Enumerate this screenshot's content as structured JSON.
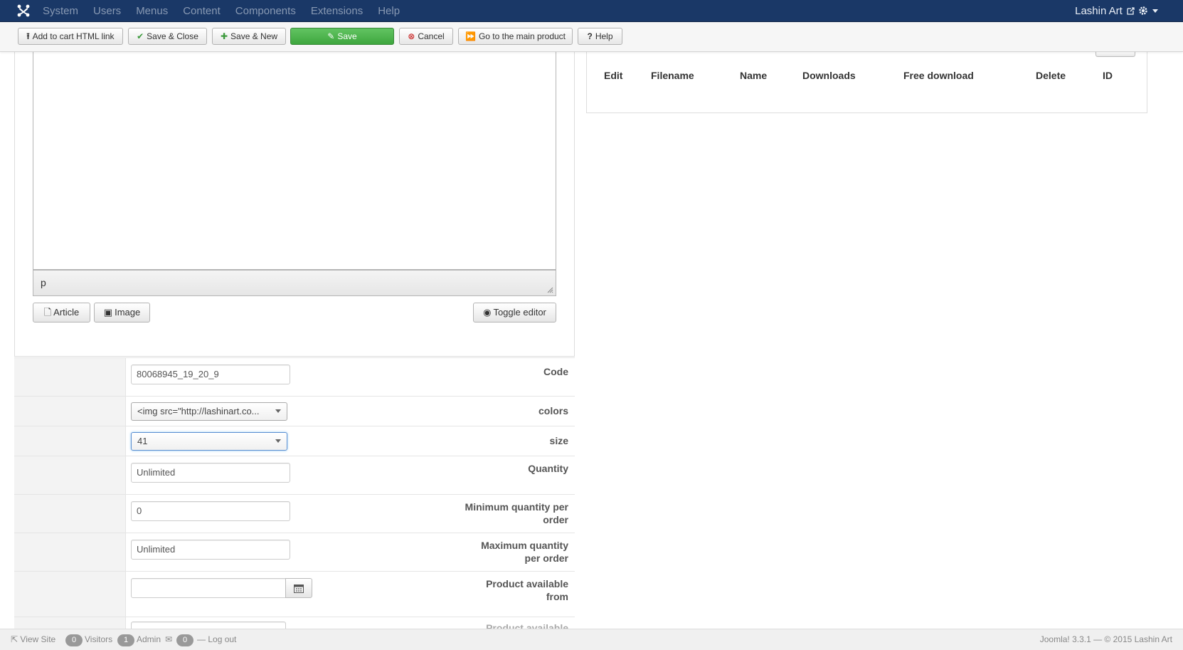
{
  "navbar": {
    "menu": [
      "System",
      "Users",
      "Menus",
      "Content",
      "Components",
      "Extensions",
      "Help"
    ],
    "user": "Lashin Art",
    "colors": {
      "bg": "#1a3867",
      "menu_text": "#8899b3"
    }
  },
  "toolbar": {
    "add_to_cart": "Add to cart HTML link",
    "save_close": "Save & Close",
    "save_new": "Save & New",
    "save": "Save",
    "cancel": "Cancel",
    "go_main": "Go to the main product",
    "help": "Help"
  },
  "editor": {
    "path": "p",
    "article_label": "Article",
    "image_label": "Image",
    "toggle_label": "Toggle editor"
  },
  "files_table": {
    "headers": [
      "Edit",
      "Filename",
      "Name",
      "Downloads",
      "Free download",
      "Delete",
      "ID"
    ]
  },
  "form": {
    "code_label": "Code",
    "code_value": "80068945_19_20_9",
    "colors_label": "colors",
    "colors_value": "<img src=\"http://lashinart.co...",
    "size_label": "size",
    "size_value": "41",
    "quantity_label": "Quantity",
    "quantity_value": "Unlimited",
    "min_qty_label_1": "Minimum quantity per",
    "min_qty_label_2": "order",
    "min_qty_value": "0",
    "max_qty_label_1": "Maximum quantity",
    "max_qty_label_2": "per order",
    "max_qty_value": "Unlimited",
    "avail_from_label_1": "Product available",
    "avail_from_label_2": "from",
    "avail_from_value": "",
    "avail_next_label": "Product available"
  },
  "footer": {
    "view_site": "View Site",
    "visitors_count": "0",
    "visitors": "Visitors",
    "admin_count": "1",
    "admin": "Admin",
    "messages_count": "0",
    "logout": "Log out",
    "copyright": "Joomla! 3.3.1 — © 2015 Lashin Art"
  }
}
